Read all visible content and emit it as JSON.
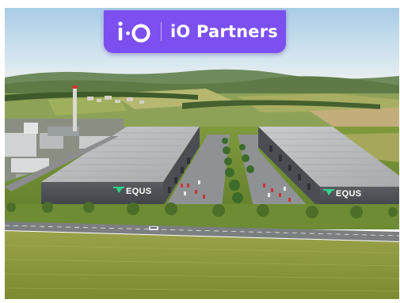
{
  "badge": {
    "logo_icon": "io-logo-icon",
    "name": "iO Partners",
    "background": "#7c4ff0"
  },
  "photo": {
    "building_left_sign": "EQUS",
    "building_right_sign": "EQUS",
    "sign_color": "#2fd48a"
  }
}
